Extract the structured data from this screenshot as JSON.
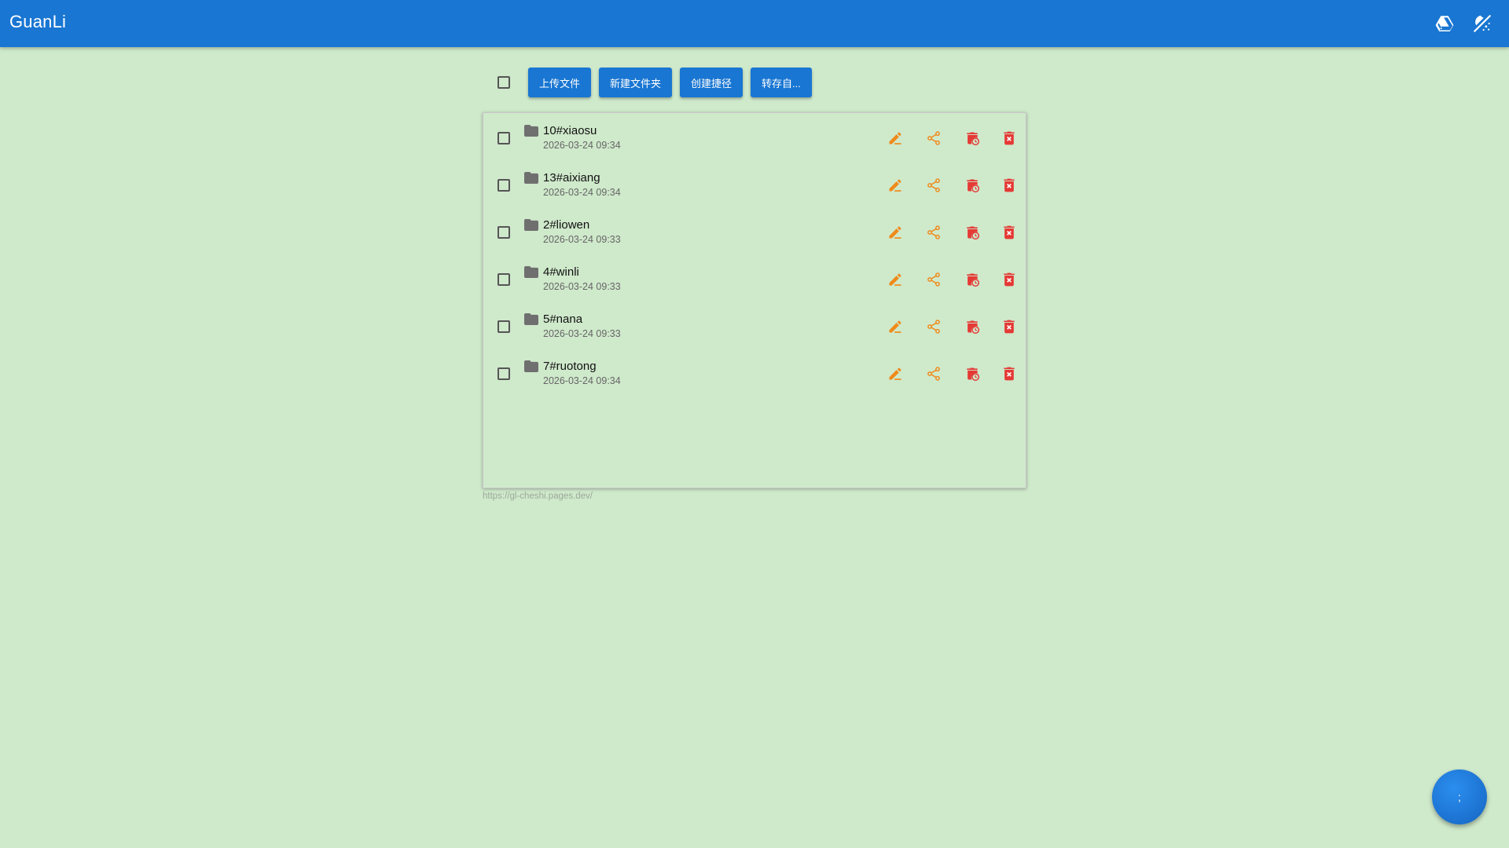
{
  "app": {
    "title": "GuanLi",
    "icons": [
      "google-drive-icon",
      "theme-toggle-icon"
    ]
  },
  "toolbar": {
    "upload_label": "上传文件",
    "new_folder_label": "新建文件夹",
    "create_shortcut_label": "创建捷径",
    "transfer_label": "转存自..."
  },
  "files": [
    {
      "name": "10#xiaosu",
      "date": "2026-03-24 09:34"
    },
    {
      "name": "13#aixiang",
      "date": "2026-03-24 09:34"
    },
    {
      "name": "2#liowen",
      "date": "2026-03-24 09:33"
    },
    {
      "name": "4#winli",
      "date": "2026-03-24 09:33"
    },
    {
      "name": "5#nana",
      "date": "2026-03-24 09:33"
    },
    {
      "name": "7#ruotong",
      "date": "2026-03-24 09:34"
    }
  ],
  "row_actions": [
    "rename-icon",
    "share-icon",
    "schedule-delete-icon",
    "delete-icon"
  ],
  "footer": {
    "url": "https://gl-cheshi.pages.dev/"
  },
  "fab": {
    "label": ";"
  },
  "colors": {
    "primary": "#1976d2",
    "background": "#cfe9cb",
    "action_orange": "#ef8a1a",
    "action_red": "#e53935"
  }
}
